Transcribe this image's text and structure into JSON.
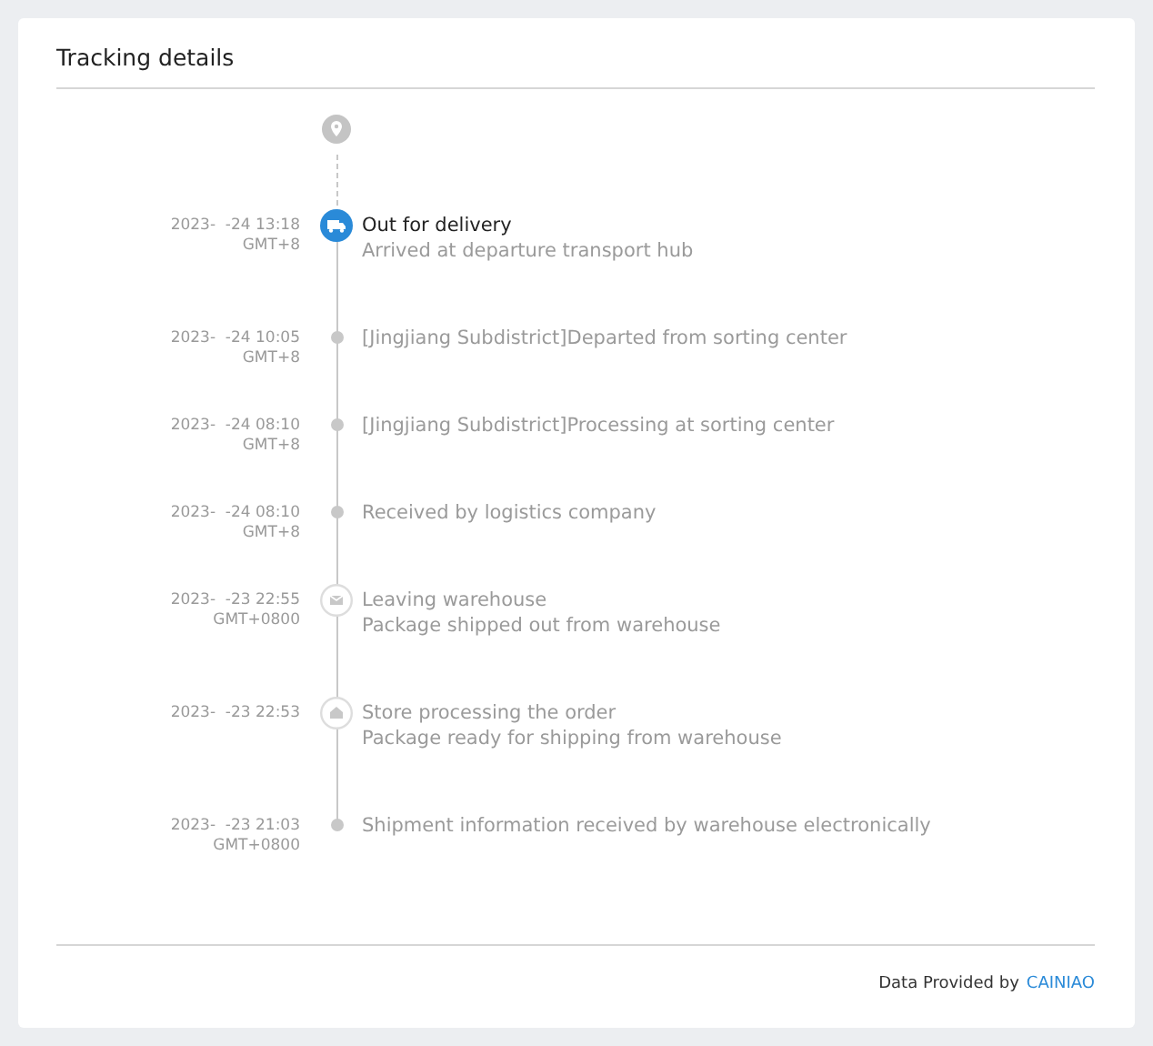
{
  "title": "Tracking details",
  "events": [
    {
      "kind": "current",
      "date": "2023-  -24 13:18",
      "zone": "GMT+8",
      "title": "Out for delivery",
      "detail": "Arrived at departure transport hub"
    },
    {
      "kind": "dot",
      "date": "2023-  -24 10:05",
      "zone": "GMT+8",
      "title": "[Jingjiang Subdistrict]Departed from sorting center"
    },
    {
      "kind": "dot",
      "date": "2023-  -24 08:10",
      "zone": "GMT+8",
      "title": "[Jingjiang Subdistrict]Processing at sorting center"
    },
    {
      "kind": "dot",
      "date": "2023-  -24 08:10",
      "zone": "GMT+8",
      "title": "Received by logistics company"
    },
    {
      "kind": "warehouse",
      "date": "2023-  -23 22:55",
      "zone": "GMT+0800",
      "title": "Leaving warehouse",
      "detail": "Package shipped out from warehouse"
    },
    {
      "kind": "store",
      "date": "2023-  -23 22:53",
      "title": "Store processing the order",
      "detail": "Package ready for shipping from warehouse"
    },
    {
      "kind": "dot",
      "date": "2023-  -23 21:03",
      "zone": "GMT+0800",
      "title": "Shipment information received by warehouse electronically"
    }
  ],
  "footer": {
    "text": "Data Provided by",
    "link": "CAINIAO"
  }
}
